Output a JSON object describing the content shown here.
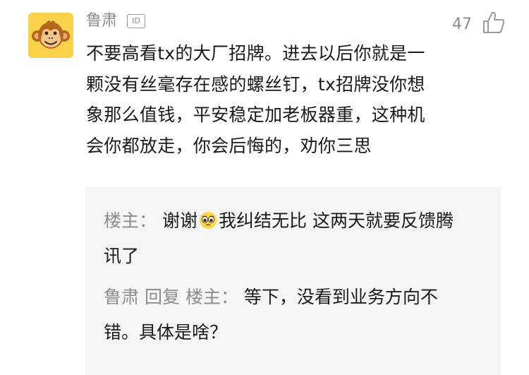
{
  "comment": {
    "author": "鲁肃",
    "id_badge": "ID",
    "like_count": "47",
    "lines": [
      "不要高看tx的大厂招牌。进去以后你就是一",
      "颗没有丝毫存在感的螺丝钉，tx招牌没你想",
      "象那么值钱，平安稳定加老板器重，这种机",
      "会你都放走，你会后悔的，劝你三思"
    ]
  },
  "replies": [
    {
      "author": "楼主",
      "separator": "：",
      "text_before_emoji": "谢谢",
      "emoji": "crying-eyes-emoji",
      "text_after_emoji": "我纠结无比 这两天就要反馈腾",
      "text_line2": "讯了"
    },
    {
      "author": "鲁肃",
      "reply_word": "回复",
      "target": "楼主",
      "separator": "：",
      "text_line1": "等下，没看到业务方向不",
      "text_line2": "错。具体是啥？"
    }
  ],
  "colors": {
    "avatar_bg": "#f9d24a",
    "muted_text": "#8c8c8c",
    "body_text": "#1a1a1a",
    "reply_bg": "#f5f5f5"
  }
}
